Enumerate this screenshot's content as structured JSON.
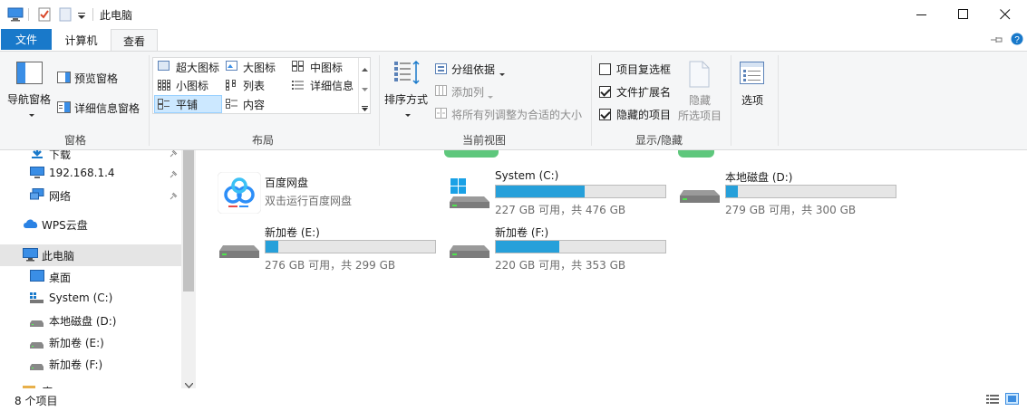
{
  "window": {
    "title": "此电脑"
  },
  "tabs": {
    "file": "文件",
    "computer": "计算机",
    "view": "查看"
  },
  "ribbon": {
    "panes": {
      "nav_pane": "导航窗格",
      "preview_pane": "预览窗格",
      "details_pane": "详细信息窗格",
      "group_label": "窗格"
    },
    "layout": {
      "extra_large": "超大图标",
      "large": "大图标",
      "medium": "中图标",
      "small": "小图标",
      "list": "列表",
      "details": "详细信息",
      "tiles": "平铺",
      "content": "内容",
      "group_label": "布局"
    },
    "current_view": {
      "sort_by": "排序方式",
      "group_by": "分组依据",
      "add_columns": "添加列",
      "size_all_columns": "将所有列调整为合适的大小",
      "group_label": "当前视图"
    },
    "show_hide": {
      "item_checkboxes": "项目复选框",
      "file_extensions": "文件扩展名",
      "hidden_items": "隐藏的项目",
      "hide_selected_line1": "隐藏",
      "hide_selected_line2": "所选项目",
      "group_label": "显示/隐藏",
      "item_checkboxes_checked": false,
      "file_extensions_checked": true,
      "hidden_items_checked": true
    },
    "options": "选项"
  },
  "nav": {
    "items": [
      {
        "label": "下载",
        "icon": "download-icon"
      },
      {
        "label": "192.168.1.4",
        "icon": "network-pc-icon"
      },
      {
        "label": "网络",
        "icon": "network-icon"
      },
      {
        "label": "WPS云盘",
        "icon": "cloud-icon"
      },
      {
        "label": "此电脑",
        "icon": "this-pc-icon"
      },
      {
        "label": "桌面",
        "icon": "desktop-icon"
      },
      {
        "label": "System (C:)",
        "icon": "drive-icon"
      },
      {
        "label": "本地磁盘 (D:)",
        "icon": "drive-icon"
      },
      {
        "label": "新加卷 (E:)",
        "icon": "drive-icon"
      },
      {
        "label": "新加卷 (F:)",
        "icon": "drive-icon"
      },
      {
        "label": "库",
        "icon": "library-icon"
      }
    ]
  },
  "content": {
    "baidu": {
      "name": "百度网盘",
      "sub": "双击运行百度网盘"
    },
    "drives": [
      {
        "name": "System (C:)",
        "info": "227 GB 可用，共 476 GB",
        "used_fraction": 0.523
      },
      {
        "name": "本地磁盘 (D:)",
        "info": "279 GB 可用，共 300 GB",
        "used_fraction": 0.07
      },
      {
        "name": "新加卷 (E:)",
        "info": "276 GB 可用，共 299 GB",
        "used_fraction": 0.077
      },
      {
        "name": "新加卷 (F:)",
        "info": "220 GB 可用，共 353 GB",
        "used_fraction": 0.377
      }
    ]
  },
  "status": {
    "count": "8 个项目"
  },
  "colors": {
    "accent": "#1979ca",
    "bar_fill": "#26a0da",
    "selected": "#cce8ff"
  }
}
